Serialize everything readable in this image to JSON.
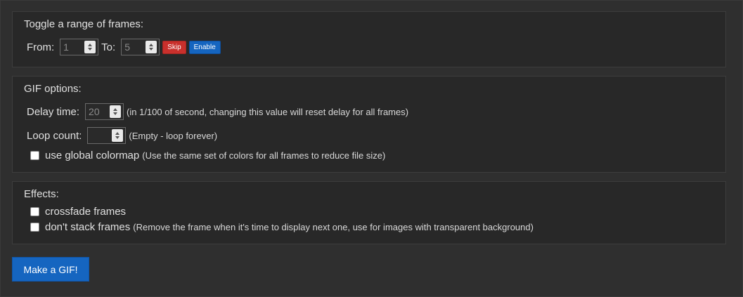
{
  "range_panel": {
    "title": "Toggle a range of frames:",
    "from_label": "From:",
    "from_value": "1",
    "to_label": "To:",
    "to_value": "5",
    "skip_label": "Skip",
    "enable_label": "Enable",
    "skip_color": "#c9302c",
    "enable_color": "#1565c0"
  },
  "gif_panel": {
    "title": "GIF options:",
    "delay_label": "Delay time:",
    "delay_value": "20",
    "delay_hint": "(in 1/100 of second, changing this value will reset delay for all frames)",
    "loop_label": "Loop count:",
    "loop_value": "",
    "loop_hint": "(Empty - loop forever)",
    "colormap_label": "use global colormap",
    "colormap_hint": "(Use the same set of colors for all frames to reduce file size)",
    "colormap_checked": false
  },
  "effects_panel": {
    "title": "Effects:",
    "crossfade_label": "crossfade frames",
    "crossfade_checked": false,
    "nostack_label": "don't stack frames",
    "nostack_hint": "(Remove the frame when it's time to display next one, use for images with transparent background)",
    "nostack_checked": false
  },
  "make_gif_label": "Make a GIF!"
}
